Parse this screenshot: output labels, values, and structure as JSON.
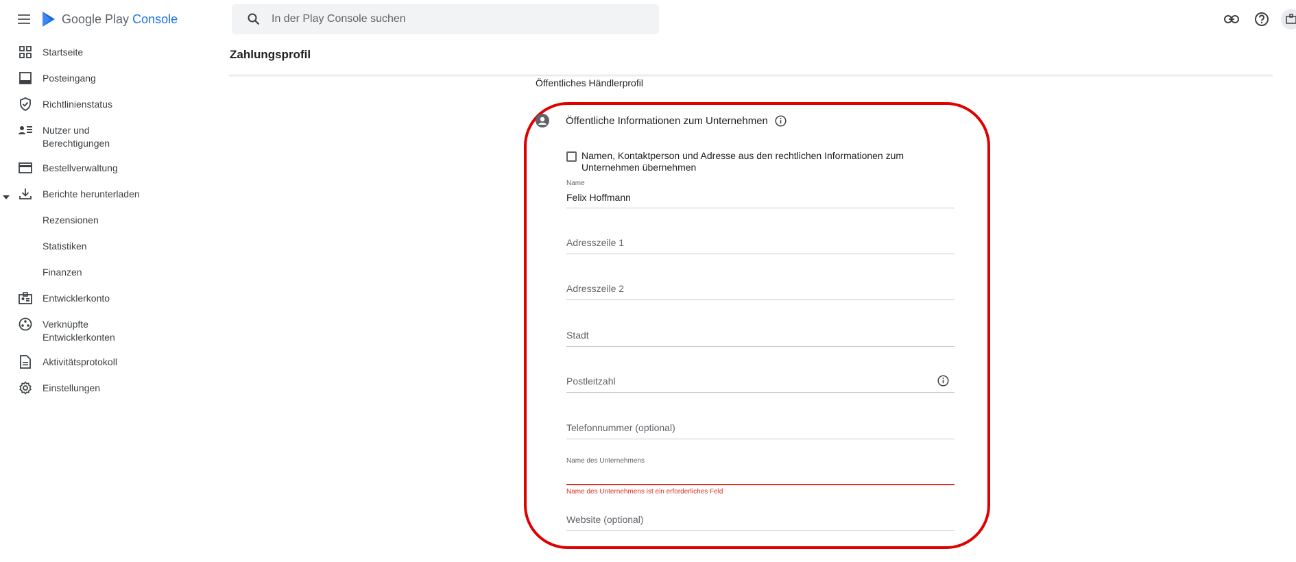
{
  "app": {
    "brand_primary": "Google Play",
    "brand_secondary": "Console",
    "brand_color": "#1a73e8"
  },
  "search": {
    "placeholder": "In der Play Console suchen"
  },
  "sidebar": {
    "items": [
      {
        "label": "Startseite",
        "icon": "dashboard-icon"
      },
      {
        "label": "Posteingang",
        "icon": "inbox-icon"
      },
      {
        "label": "Richtlinienstatus",
        "icon": "shield-icon"
      },
      {
        "label": "Nutzer und Berechtigungen",
        "icon": "manage-accounts-icon"
      },
      {
        "label": "Bestellverwaltung",
        "icon": "credit-card-icon"
      },
      {
        "label": "Berichte herunterladen",
        "icon": "download-icon",
        "expanded": true
      },
      {
        "label": "Rezensionen",
        "sub": true
      },
      {
        "label": "Statistiken",
        "sub": true
      },
      {
        "label": "Finanzen",
        "sub": true
      },
      {
        "label": "Entwicklerkonto",
        "icon": "badge-icon"
      },
      {
        "label": "Verknüpfte Entwicklerkonten",
        "icon": "linked-accounts-icon"
      },
      {
        "label": "Aktivitätsprotokoll",
        "icon": "document-icon"
      },
      {
        "label": "Einstellungen",
        "icon": "gear-icon"
      }
    ]
  },
  "page": {
    "title": "Zahlungsprofil",
    "section_title": "Öffentliches Händlerprofil"
  },
  "public_info": {
    "title": "Öffentliche Informationen zum Unternehmen",
    "checkbox_label": "Namen, Kontaktperson und Adresse aus den rechtlichen Informationen zum Unternehmen übernehmen",
    "checkbox_checked": false,
    "fields": {
      "name": {
        "label": "Name",
        "value": "Felix Hoffmann"
      },
      "address1": {
        "placeholder": "Adresszeile 1"
      },
      "address2": {
        "placeholder": "Adresszeile 2"
      },
      "city": {
        "placeholder": "Stadt"
      },
      "postal": {
        "placeholder": "Postleitzahl"
      },
      "phone": {
        "placeholder": "Telefonnummer (optional)"
      },
      "company": {
        "label": "Name des Unternehmens",
        "value": "",
        "error": "Name des Unternehmens ist ein erforderliches Feld"
      },
      "website": {
        "placeholder": "Website (optional)"
      }
    }
  },
  "colors": {
    "error": "#d93025",
    "highlight": "#e00000"
  }
}
